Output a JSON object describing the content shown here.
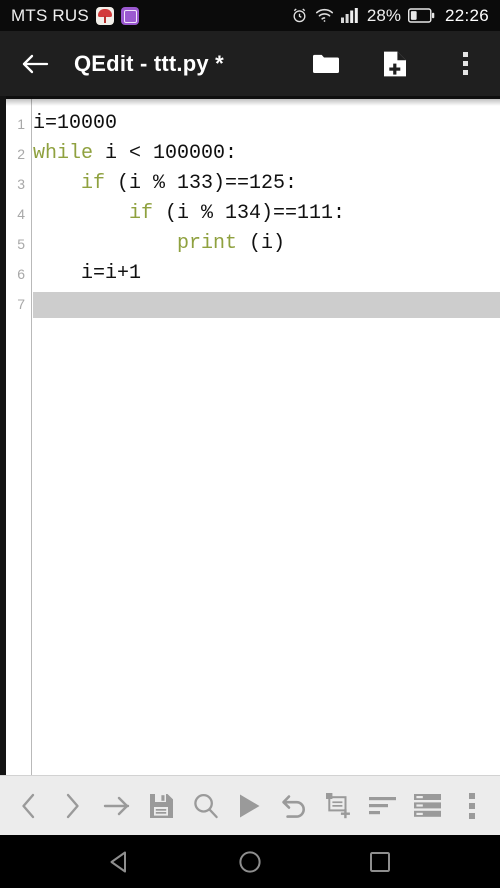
{
  "status_bar": {
    "carrier": "MTS RUS",
    "notification_icons": [
      "mushroom-app-icon",
      "purple-app-icon"
    ],
    "system_icons": [
      "alarm-icon",
      "wifi-icon",
      "signal-icon"
    ],
    "battery_percent": "28%",
    "battery_level": 28,
    "clock": "22:26",
    "background": "#0b0b0b"
  },
  "app_bar": {
    "back_label": "back-arrow",
    "title": "QEdit - ttt.py *",
    "actions": [
      {
        "name": "open-folder",
        "icon": "folder-icon"
      },
      {
        "name": "new-file",
        "icon": "file-plus-icon"
      },
      {
        "name": "overflow-menu",
        "icon": "kebab-menu-icon"
      }
    ],
    "background": "#1f1f1f"
  },
  "editor": {
    "keyword_color": "#8fa13f",
    "text_color": "#111111",
    "gutter_color": "#a8a8a8",
    "current_line_highlight": "#cdcdcd",
    "current_line": 7,
    "lines": [
      {
        "number": "1",
        "segments": [
          {
            "t": "i=10000",
            "k": false
          }
        ]
      },
      {
        "number": "2",
        "segments": [
          {
            "t": "while",
            "k": true
          },
          {
            "t": " i < 100000:",
            "k": false
          }
        ]
      },
      {
        "number": "3",
        "segments": [
          {
            "t": "    ",
            "k": false
          },
          {
            "t": "if",
            "k": true
          },
          {
            "t": " (i % 133)==125:",
            "k": false
          }
        ]
      },
      {
        "number": "4",
        "segments": [
          {
            "t": "        ",
            "k": false
          },
          {
            "t": "if",
            "k": true
          },
          {
            "t": " (i % 134)==111:",
            "k": false
          }
        ]
      },
      {
        "number": "5",
        "segments": [
          {
            "t": "            ",
            "k": false
          },
          {
            "t": "print",
            "k": true
          },
          {
            "t": " (i)",
            "k": false
          }
        ]
      },
      {
        "number": "6",
        "segments": [
          {
            "t": "    i=i+1",
            "k": false
          }
        ]
      },
      {
        "number": "7",
        "segments": []
      }
    ]
  },
  "tool_bar": {
    "background": "#ececec",
    "icon_color": "#9a9a9a",
    "buttons": [
      {
        "name": "nav-back-button",
        "icon": "chevron-left-icon"
      },
      {
        "name": "nav-forward-button",
        "icon": "chevron-right-icon"
      },
      {
        "name": "goto-line-button",
        "icon": "arrow-right-icon"
      },
      {
        "name": "save-button",
        "icon": "floppy-disk-icon"
      },
      {
        "name": "search-button",
        "icon": "magnifier-icon"
      },
      {
        "name": "run-button",
        "icon": "play-icon"
      },
      {
        "name": "undo-button",
        "icon": "undo-arrow-icon"
      },
      {
        "name": "new-tab-button",
        "icon": "window-plus-icon"
      },
      {
        "name": "format-lines-button",
        "icon": "align-left-icon"
      },
      {
        "name": "list-view-button",
        "icon": "list-rows-icon"
      },
      {
        "name": "toolbar-overflow-button",
        "icon": "kebab-menu-icon"
      }
    ]
  },
  "nav_bar": {
    "background": "#000000",
    "buttons": [
      {
        "name": "android-back-button",
        "icon": "triangle-left-icon"
      },
      {
        "name": "android-home-button",
        "icon": "circle-icon"
      },
      {
        "name": "android-recents-button",
        "icon": "square-icon"
      }
    ]
  }
}
